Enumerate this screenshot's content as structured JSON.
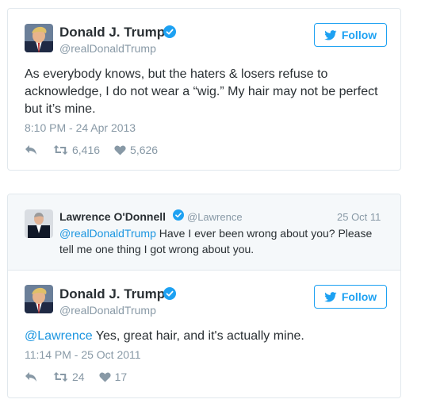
{
  "tweet1": {
    "author_name": "Donald J. Trump",
    "author_handle": "@realDonaldTrump",
    "follow_label": "Follow",
    "text": "As everybody knows, but the haters & losers refuse to acknowledge, I do not wear a “wig.” My hair may not be perfect but it’s mine.",
    "timestamp": "8:10 PM - 24 Apr 2013",
    "retweets": "6,416",
    "likes": "5,626"
  },
  "thread": {
    "quoted": {
      "author_name": "Lawrence O'Donnell",
      "author_handle": "@Lawrence",
      "date": "25 Oct 11",
      "mention": "@realDonaldTrump",
      "text": " Have I ever been wrong about you? Please tell me one thing I got wrong about you."
    },
    "reply": {
      "author_name": "Donald J. Trump",
      "author_handle": "@realDonaldTrump",
      "follow_label": "Follow",
      "mention": "@Lawrence",
      "text": " Yes, great hair, and it's actually mine.",
      "timestamp": "11:14 PM - 25 Oct 2011",
      "retweets": "24",
      "likes": "17"
    }
  },
  "colors": {
    "twitter_blue": "#1da1f2",
    "link_blue": "#1b95e0",
    "muted_gray": "#8899a6",
    "border": "#e1e8ed",
    "quoted_bg": "#f5f8fa"
  },
  "icons": {
    "verified": "verified-badge-icon",
    "follow": "twitter-bird-icon",
    "reply": "reply-icon",
    "retweet": "retweet-icon",
    "like": "heart-icon"
  }
}
